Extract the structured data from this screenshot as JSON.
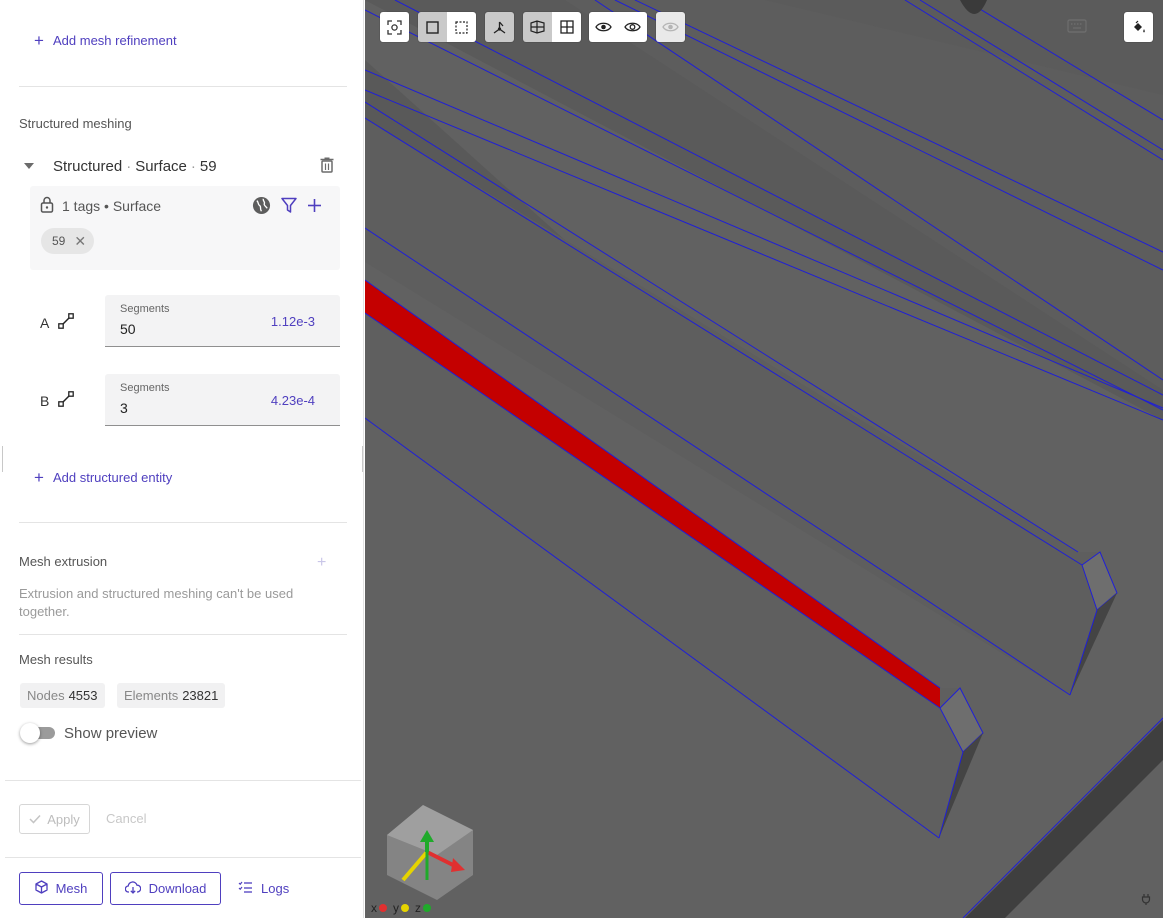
{
  "panel": {
    "add_mesh_refinement": "Add mesh refinement",
    "structured_meshing_title": "Structured meshing",
    "structured_item": {
      "kind": "Structured",
      "dim": "Surface",
      "tag": "59",
      "tags_summary": "1 tags • Surface",
      "chips": [
        "59"
      ]
    },
    "segments": [
      {
        "edge": "A",
        "label": "Segments",
        "value": "50",
        "size": "1.12e-3"
      },
      {
        "edge": "B",
        "label": "Segments",
        "value": "3",
        "size": "4.23e-4"
      }
    ],
    "add_structured_entity": "Add structured entity",
    "mesh_extrusion_title": "Mesh extrusion",
    "extrusion_note": "Extrusion and structured meshing can't be used together.",
    "mesh_results_title": "Mesh results",
    "nodes_label": "Nodes",
    "nodes_value": "4553",
    "elements_label": "Elements",
    "elements_value": "23821",
    "show_preview": "Show preview",
    "show_preview_on": false,
    "apply": "Apply",
    "cancel": "Cancel",
    "mesh": "Mesh",
    "download": "Download",
    "logs": "Logs"
  },
  "viewport": {
    "axes": {
      "x": "x",
      "y": "y",
      "z": "z"
    },
    "colors": {
      "background": "#5e5e5e",
      "selected_face": "#c40000",
      "edges": "#1f1fd6",
      "accent": "#4f3fbf",
      "sky": "#e1f1fb"
    },
    "toolbar_icons": [
      "fit-view-icon",
      "select-box-icon",
      "select-dashed-icon",
      "vertex-select-icon",
      "face-view-icon",
      "grid-view-icon",
      "hide-icon",
      "show-icon",
      "visibility-disabled-icon",
      "keyboard-icon",
      "paint-bucket-icon"
    ]
  }
}
